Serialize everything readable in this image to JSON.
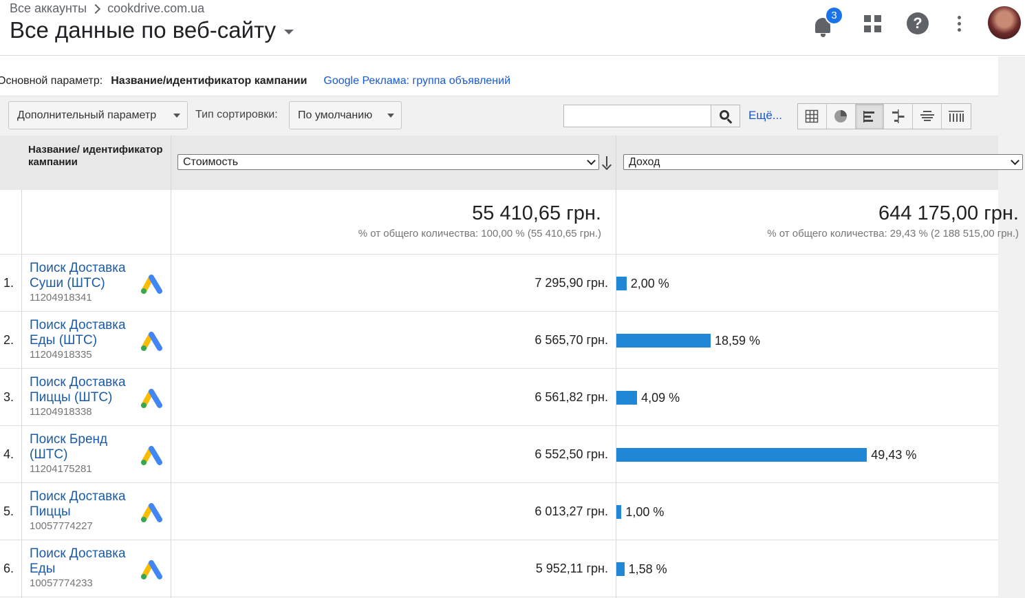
{
  "header": {
    "breadcrumb_root": "Все аккаунты",
    "breadcrumb_property": "cookdrive.com.ua",
    "view_title": "Все данные по веб-сайту",
    "notifications_count": "3"
  },
  "dimension": {
    "label": "Основной параметр:",
    "selected": "Название/идентификатор кампании",
    "alternative": "Google Реклама: группа объявлений"
  },
  "toolbar": {
    "secondary_dimension": "Дополнительный параметр",
    "sort_label": "Тип сортировки:",
    "sort_value": "По умолчанию",
    "search_value": "",
    "more_link": "Ещё...",
    "active_view": "performance"
  },
  "table": {
    "column_name": "Название/ идентификатор кампании",
    "metric_primary": "Стоимость",
    "metric_compare": "Доход",
    "totals": {
      "primary_value": "55 410,65 грн.",
      "primary_share": "% от общего количества: 100,00 % (55 410,65 грн.)",
      "compare_value": "644 175,00 грн.",
      "compare_share": "% от общего количества: 29,43 % (2 188 515,00 грн.)"
    },
    "rows": [
      {
        "num": "1.",
        "name": "Поиск Доставка Суши (ШТС)",
        "id": "11204918341",
        "cost": "7 295,90 грн.",
        "pct": "2,00 %",
        "pct_value": 2.0
      },
      {
        "num": "2.",
        "name": "Поиск Доставка Еды (ШТС)",
        "id": "11204918335",
        "cost": "6 565,70 грн.",
        "pct": "18,59 %",
        "pct_value": 18.59
      },
      {
        "num": "3.",
        "name": "Поиск Доставка Пиццы (ШТС)",
        "id": "11204918338",
        "cost": "6 561,82 грн.",
        "pct": "4,09 %",
        "pct_value": 4.09
      },
      {
        "num": "4.",
        "name": "Поиск Бренд (ШТС)",
        "id": "11204175281",
        "cost": "6 552,50 грн.",
        "pct": "49,43 %",
        "pct_value": 49.43
      },
      {
        "num": "5.",
        "name": "Поиск Доставка Пиццы",
        "id": "10057774227",
        "cost": "6 013,27 грн.",
        "pct": "1,00 %",
        "pct_value": 1.0
      },
      {
        "num": "6.",
        "name": "Поиск Доставка Еды",
        "id": "10057774233",
        "cost": "5 952,11 грн.",
        "pct": "1,58 %",
        "pct_value": 1.58
      }
    ]
  },
  "colors": {
    "bar": "#1f87d6",
    "link": "#1a5aa6",
    "badge": "#1a73e8"
  }
}
